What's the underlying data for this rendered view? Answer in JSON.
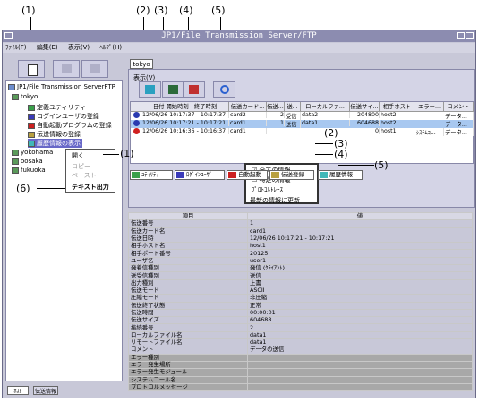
{
  "callouts": [
    "(1)",
    "(2)",
    "(3)",
    "(4)",
    "(5)",
    "(2)",
    "(3)",
    "(4)",
    "(5)",
    "(1)",
    "(6)"
  ],
  "window": {
    "title": "JP1/File Transmission Server/FTP"
  },
  "menubar": [
    "ﾌｧｲﾙ(F)",
    "編集(E)",
    "表示(V)",
    "ﾍﾙﾌﾟ(H)"
  ],
  "tree": {
    "root": "JP1/File Transmission ServerFTP",
    "host1": "tokyo",
    "children": [
      "定義ユティリティ",
      "ログインユーザの登録",
      "自動起動プログラムの登録",
      "伝送情報の登録",
      "履歴情報の表示"
    ],
    "host2": "yokohama",
    "host3": "oosaka",
    "host4": "fukuoka"
  },
  "context_menu": {
    "open": "開く",
    "copy": "コピー",
    "paste": "ペースト",
    "text_out": "テキスト出力"
  },
  "left_tabs": [
    "ﾎｽﾄ",
    "伝送情報"
  ],
  "right_tab": "tokyo",
  "display_label": "表示(V)",
  "grid": {
    "headers": [
      "日付 開始時刻 - 終了時刻",
      "伝送カード...",
      "伝送...",
      "送...",
      "ローカルファ...",
      "伝送サイ...",
      "相手ホスト",
      "エラー...",
      "コメント"
    ],
    "rows": [
      [
        "12/06/26 10:17:37 - 10:17:37",
        "card2",
        "2",
        "受信",
        "data2",
        "204800",
        "host2",
        "",
        "データ..."
      ],
      [
        "12/06/26 10:17:21 - 10:17:21",
        "card1",
        "1",
        "送信",
        "data1",
        "604688",
        "host2",
        "",
        "データ..."
      ],
      [
        "12/06/26 10:16:36 - 10:16:37",
        "card1",
        "",
        "",
        "",
        "0",
        "host1",
        "ｼｽﾃﾑｺ...",
        "データ..."
      ]
    ]
  },
  "view_menu": {
    "all": "全ての情報",
    "specific": "特定の情報",
    "protocol": "ﾌﾟﾛﾄｺﾙﾄﾚｰｽ",
    "refresh": "最新の情報に更新"
  },
  "bottom_tabs": [
    "ﾕﾃｨﾘﾃｨ",
    "ﾛｸﾞｲﾝﾕｰｻﾞ",
    "自動起動",
    "伝送登録",
    "履歴情報"
  ],
  "details": {
    "header": [
      "項目",
      "値"
    ],
    "rows": [
      [
        "伝送番号",
        "1"
      ],
      [
        "伝送カード名",
        "card1"
      ],
      [
        "伝送日時",
        "12/06/26 10:17:21 - 10:17:21"
      ],
      [
        "相手ホスト名",
        "host1"
      ],
      [
        "相手ポート番号",
        "20125"
      ],
      [
        "ユーザ名",
        "user1"
      ],
      [
        "発着信種別",
        "発信 (ｸﾗｲｱﾝﾄ)"
      ],
      [
        "送受信種別",
        "送信"
      ],
      [
        "出力種別",
        "上書"
      ],
      [
        "伝送モード",
        "ASCII"
      ],
      [
        "圧縮モード",
        "非圧縮"
      ],
      [
        "伝送終了状態",
        "正常"
      ],
      [
        "伝送時間",
        "00:00:01"
      ],
      [
        "伝送サイズ",
        "604688"
      ],
      [
        "接続番号",
        "2"
      ],
      [
        "ローカルファイル名",
        "data1"
      ],
      [
        "リモートファイル名",
        "data1"
      ],
      [
        "コメント",
        "データの送信"
      ],
      [
        "エラー種別",
        ""
      ],
      [
        "エラー発生場所",
        ""
      ],
      [
        "エラー発生モジュール",
        ""
      ],
      [
        "システムコール名",
        ""
      ],
      [
        "プロトコルメッセージ",
        ""
      ]
    ]
  }
}
